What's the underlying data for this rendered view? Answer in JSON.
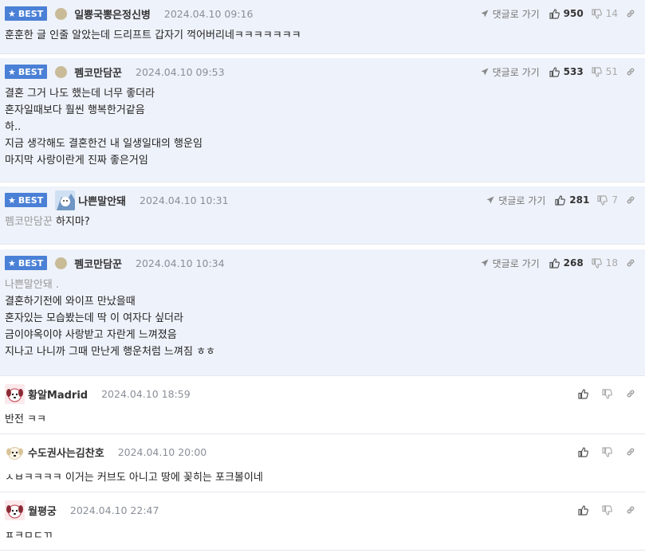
{
  "labels": {
    "best": "BEST",
    "reply": "댓글로 가기"
  },
  "comments": [
    {
      "best": true,
      "nick": "일뿅국뽕은정신병",
      "date": "2024.04.10 09:16",
      "up": "950",
      "down": "14",
      "mention": "",
      "lines": [
        "훈훈한 글 인줄 알았는데 드리프트 갑자기 꺽어버리네ㅋㅋㅋㅋㅋㅋㅋ"
      ]
    },
    {
      "best": true,
      "nick": "펨코만담꾼",
      "date": "2024.04.10 09:53",
      "up": "533",
      "down": "51",
      "mention": "",
      "lines": [
        "결혼 그거 나도 했는데 너무 좋더라",
        "혼자일때보다 훨씬 행복한거같음",
        "하..",
        "지금 생각해도 결혼한건 내 일생일대의 행운임",
        "마지막 사랑이란게 진짜 좋은거임"
      ]
    },
    {
      "best": true,
      "nick": "나쁜말안돼",
      "date": "2024.04.10 10:31",
      "up": "281",
      "down": "7",
      "mention": "펨코만담꾼",
      "lines": [
        "하지마?"
      ]
    },
    {
      "best": true,
      "nick": "펨코만담꾼",
      "date": "2024.04.10 10:34",
      "up": "268",
      "down": "18",
      "mention": "나쁜말안돼 .",
      "lines": [
        "결혼하기전에 와이프 만났을때",
        "혼자있는 모습봤는데 딱 이 여자다 싶더라",
        "금이야옥이야 사랑받고 자란게 느껴졌음",
        "지나고 나니까 그때 만난게 행운처럼 느껴짐 ㅎㅎ"
      ]
    },
    {
      "best": false,
      "nick": "황알Madrid",
      "date": "2024.04.10 18:59",
      "lines": [
        "반전 ㅋㅋ"
      ]
    },
    {
      "best": false,
      "nick": "수도권사는김찬호",
      "date": "2024.04.10 20:00",
      "lines": [
        "ㅅㅂㅋㅋㅋㅋ 이거는 커브도 아니고 땅에 꽂히는 포크볼이네"
      ]
    },
    {
      "best": false,
      "nick": "월평궁",
      "date": "2024.04.10 22:47",
      "lines": [
        "ㅍㅋㅁㄷㄲ"
      ]
    }
  ],
  "colors": {
    "best_bg": "#eef2fa",
    "badge": "#4a80d6",
    "border": "#e3e6ec"
  }
}
